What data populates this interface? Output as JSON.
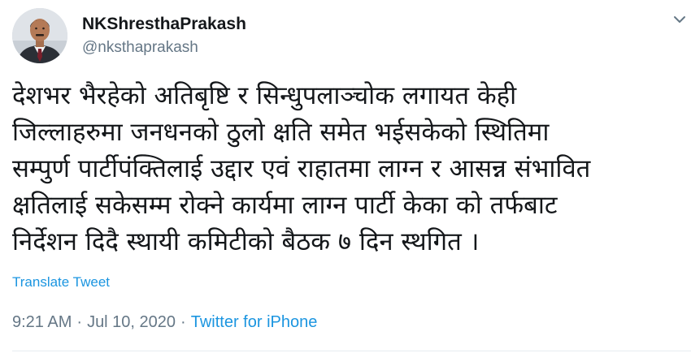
{
  "user": {
    "display_name": "NKShresthaPrakash",
    "handle": "@nksthaprakash"
  },
  "tweet": {
    "lines": [
      "देशभर भैरहेको अतिबृष्टि र सिन्धुपलाञ्चोक लगायत केही",
      "जिल्लाहरुमा जनधनको ठुलो क्षति समेत भईसकेको स्थितिमा",
      "सम्पुर्ण पार्टीपंक्तिलाई  उद्दार एवं राहातमा लाग्न र आसन्न संभावित",
      "क्षतिलाई सकेसम्म रोक्ने कार्यमा लाग्न पार्टी केका को तर्फबाट",
      "निर्देशन दिदै स्थायी कमिटीको बैठक ७ दिन स्थगित ।"
    ],
    "translate_label": "Translate Tweet",
    "time": "9:21 AM",
    "date": "Jul 10, 2020",
    "separator": "·",
    "source": "Twitter for iPhone"
  },
  "icons": {
    "avatar": "profile-photo",
    "caret": "chevron-down-icon"
  },
  "colors": {
    "text_primary": "#14171a",
    "text_secondary": "#657786",
    "link": "#1b95e0"
  }
}
